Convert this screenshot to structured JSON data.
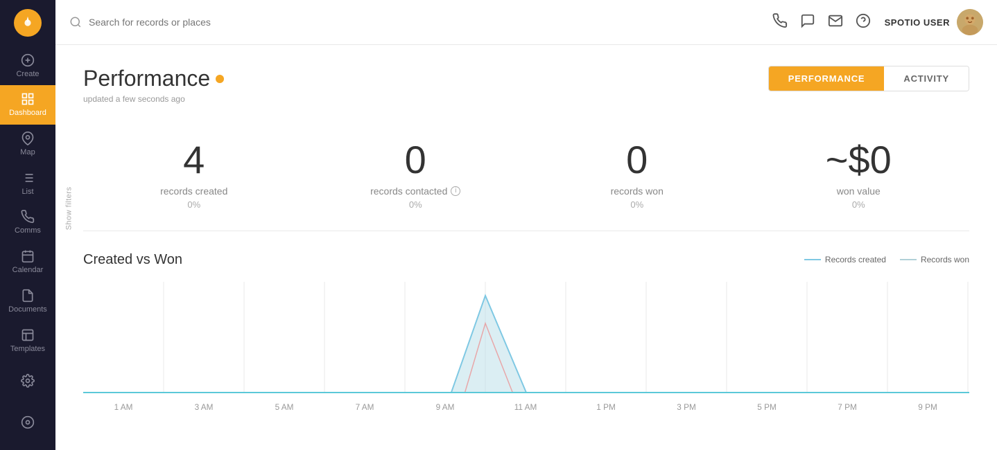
{
  "sidebar": {
    "logo": "●",
    "items": [
      {
        "id": "create",
        "label": "Create",
        "icon": "plus"
      },
      {
        "id": "dashboard",
        "label": "Dashboard",
        "icon": "dashboard",
        "active": true
      },
      {
        "id": "map",
        "label": "Map",
        "icon": "map"
      },
      {
        "id": "list",
        "label": "List",
        "icon": "list"
      },
      {
        "id": "comms",
        "label": "Comms",
        "icon": "phone"
      },
      {
        "id": "calendar",
        "label": "Calendar",
        "icon": "calendar"
      },
      {
        "id": "documents",
        "label": "Documents",
        "icon": "doc"
      },
      {
        "id": "templates",
        "label": "Templates",
        "icon": "template"
      }
    ],
    "bottom": [
      {
        "id": "settings",
        "label": "",
        "icon": "gear"
      },
      {
        "id": "location",
        "label": "",
        "icon": "location"
      }
    ]
  },
  "topbar": {
    "search_placeholder": "Search for records or places",
    "user_name": "SPOTIO USER"
  },
  "page": {
    "title": "Performance",
    "updated": "updated a few seconds ago",
    "tabs": [
      {
        "id": "performance",
        "label": "PERFORMANCE",
        "active": true
      },
      {
        "id": "activity",
        "label": "ACTIVITY",
        "active": false
      }
    ]
  },
  "stats": [
    {
      "id": "records-created",
      "value": "4",
      "label": "records created",
      "pct": "0%",
      "info": false
    },
    {
      "id": "records-contacted",
      "value": "0",
      "label": "records contacted",
      "pct": "0%",
      "info": true
    },
    {
      "id": "records-won",
      "value": "0",
      "label": "records won",
      "pct": "0%",
      "info": false
    },
    {
      "id": "won-value",
      "value": "~$0",
      "label": "won value",
      "pct": "0%",
      "info": false
    }
  ],
  "chart": {
    "title": "Created vs Won",
    "legend": [
      {
        "id": "records-created",
        "label": "Records created",
        "color": "#7ec8e3"
      },
      {
        "id": "records-won",
        "label": "Records won",
        "color": "#b0c4ce"
      }
    ],
    "x_labels": [
      "1 AM",
      "3 AM",
      "5 AM",
      "7 AM",
      "9 AM",
      "11 AM",
      "1 PM",
      "3 PM",
      "5 PM",
      "7 PM",
      "9 PM"
    ]
  },
  "filters": {
    "label": "Show filters"
  }
}
